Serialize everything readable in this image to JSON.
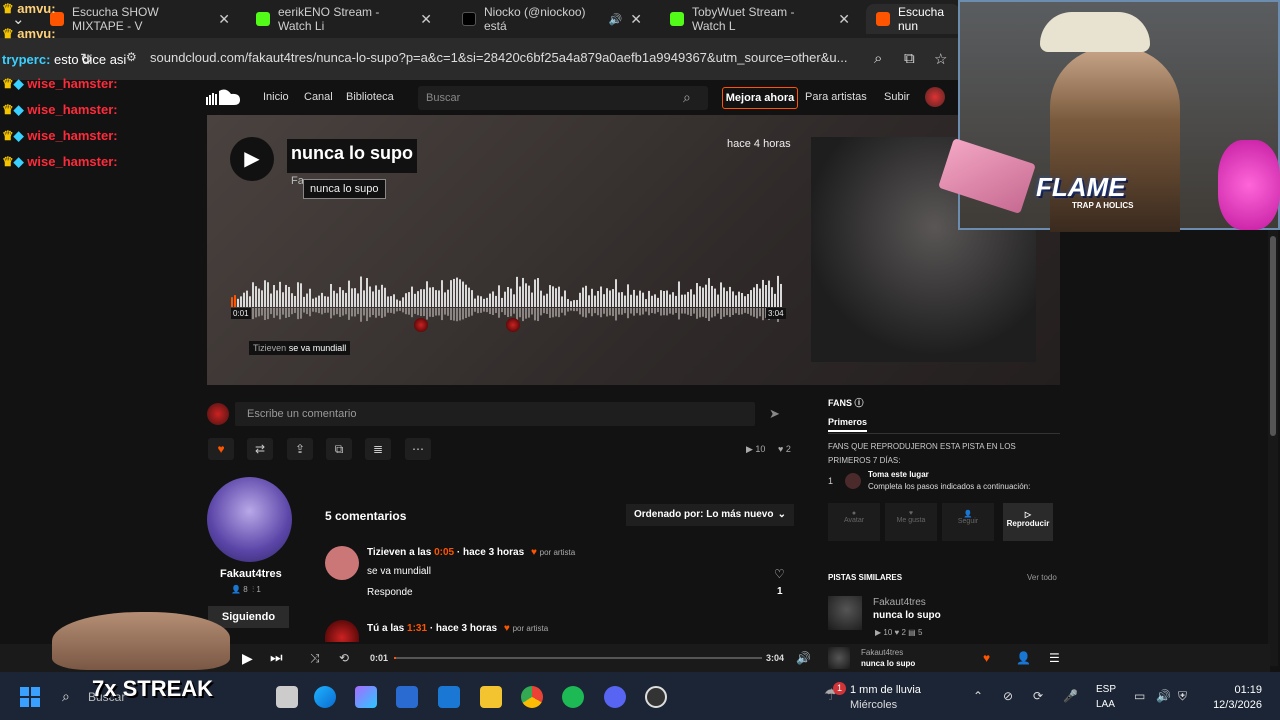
{
  "browser": {
    "tabs": [
      {
        "label": "Escucha SHOW MIXTAPE - V",
        "favicon_color": "#ff5500"
      },
      {
        "label": "eerikENO Stream - Watch Li",
        "favicon_color": "#53fc18"
      },
      {
        "label": "Niocko (@niockoo) está",
        "favicon_color": "#000000"
      },
      {
        "label": "TobyWuet Stream - Watch L",
        "favicon_color": "#53fc18"
      },
      {
        "label": "Escucha nun",
        "favicon_color": "#ff5500"
      }
    ],
    "close_glyph": "✕",
    "url": "soundcloud.com/fakaut4tres/nunca-lo-supo?p=a&c=1&si=28420c6bf25a4a879a0aefb1a9949367&utm_source=other&u..."
  },
  "chat": {
    "messages": [
      {
        "user": "amvu:",
        "text": "",
        "color": "#ffd27a"
      },
      {
        "user": "amvu:",
        "text": "",
        "color": "#ffd27a"
      },
      {
        "user": "tryperc:",
        "text": "esto dice asi",
        "color": "#3ad0ff"
      },
      {
        "user": "wise_hamster:",
        "text": "",
        "color": "#ff2a3a"
      },
      {
        "user": "wise_hamster:",
        "text": "",
        "color": "#ff2a3a"
      },
      {
        "user": "wise_hamster:",
        "text": "",
        "color": "#ff2a3a"
      },
      {
        "user": "wise_hamster:",
        "text": "",
        "color": "#ff2a3a"
      }
    ]
  },
  "nav": {
    "home": "Inicio",
    "feed": "Canal",
    "library": "Biblioteca",
    "search_placeholder": "Buscar",
    "upgrade": "Mejora ahora",
    "for_artists": "Para artistas",
    "upload": "Subir"
  },
  "track": {
    "title": "nunca lo supo",
    "tooltip": "nunca lo supo",
    "artist_partial": "Fa",
    "posted": "hace 4 horas",
    "time_start": "0:01",
    "time_end": "3:04",
    "comment_user": "Tizieven",
    "comment_text": "se va mundiall"
  },
  "comment_box": {
    "placeholder": "Escribe un comentario"
  },
  "stats": {
    "plays": "10",
    "likes": "2"
  },
  "artist": {
    "name": "Fakaut4tres",
    "followers": "8",
    "tracks": "1",
    "follow_label": "Siguiendo"
  },
  "comments": {
    "count_label": "5 comentarios",
    "sort_label": "Ordenado por: Lo más nuevo",
    "items": [
      {
        "user": "Tizieven",
        "at_label": "a las",
        "time": "0:05",
        "ago": "· hace 3 horas",
        "badge": "por artista",
        "text": "se va mundiall",
        "reply": "Responde",
        "likes": "1"
      },
      {
        "user": "Tú",
        "at_label": "a las",
        "time": "1:31",
        "ago": "· hace 3 horas",
        "badge": "por artista"
      }
    ]
  },
  "fans": {
    "title": "FANS",
    "tab": "Primeros",
    "description": "FANS QUE REPRODUJERON ESTA PISTA EN LOS PRIMEROS 7 DÍAS:",
    "rank": "1",
    "slot_title": "Toma este lugar",
    "slot_subtitle": "Completa los pasos indicados a continuación:",
    "steps": [
      "Avatar",
      "Me gusta",
      "Seguir",
      "Reproducir"
    ]
  },
  "similar": {
    "title": "PISTAS SIMILARES",
    "view_all": "Ver todo",
    "item": {
      "artist": "Fakaut4tres",
      "title": "nunca lo supo",
      "plays": "10",
      "likes": "2",
      "comments": "5"
    }
  },
  "player": {
    "current": "0:01",
    "duration": "3:04",
    "artist": "Fakaut4tres",
    "title": "nunca lo supo",
    "progress": 0.005
  },
  "overlay": {
    "flame_text": "FLAME",
    "flame_sub": "TRAP A HOLICS",
    "streak": "7x STREAK"
  },
  "taskbar": {
    "search": "Buscar",
    "weather_temp": "1 mm de lluvia",
    "weather_day": "Miércoles",
    "lang1": "ESP",
    "lang2": "LAA",
    "time": "01:19",
    "date": "12/3/2026",
    "badge": "1"
  },
  "colors": {
    "accent": "#ff5500",
    "background": "#121212"
  }
}
